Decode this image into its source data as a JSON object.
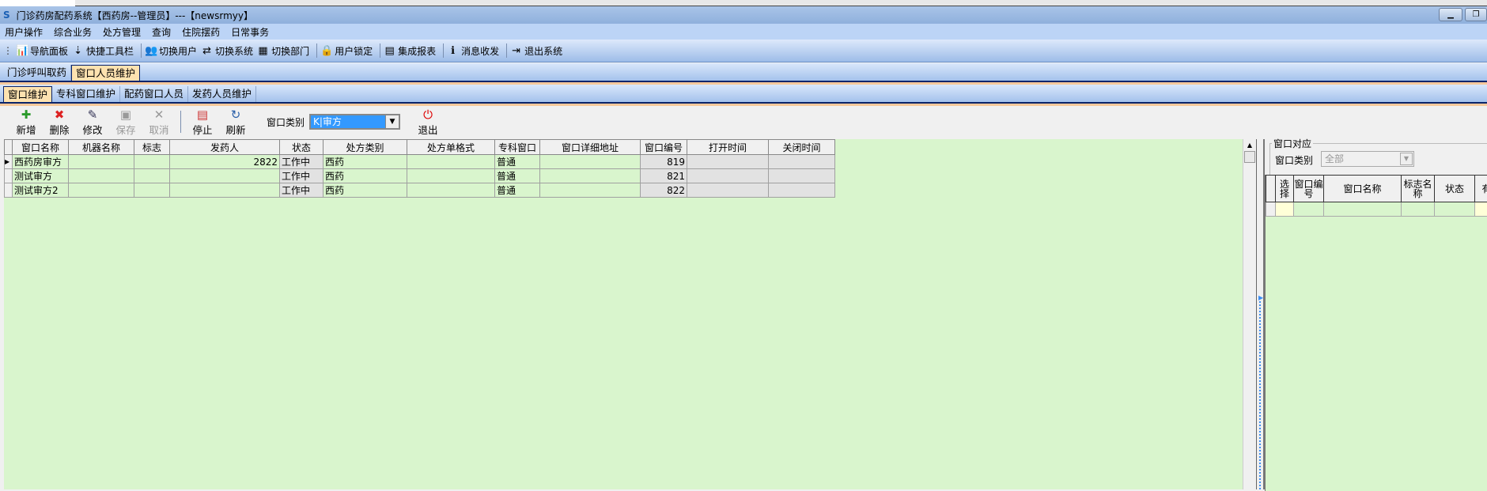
{
  "window": {
    "title": "门诊药房配药系统【西药房--管理员】---【newsrmyy】",
    "minimize_icon": "minimize-icon",
    "restore_icon": "restore-icon"
  },
  "menu": [
    "用户操作",
    "综合业务",
    "处方管理",
    "查询",
    "住院摆药",
    "日常事务"
  ],
  "toolbar": [
    {
      "label": "导航面板",
      "icon": "📊"
    },
    {
      "label": "快捷工具栏",
      "icon": "⇣"
    },
    {
      "label": "切换用户",
      "icon": "👥"
    },
    {
      "label": "切换系统",
      "icon": "⇄"
    },
    {
      "label": "切换部门",
      "icon": "▦"
    },
    {
      "label": "用户锁定",
      "icon": "🔒"
    },
    {
      "label": "集成报表",
      "icon": "▤"
    },
    {
      "label": "消息收发",
      "icon": "ℹ"
    },
    {
      "label": "退出系统",
      "icon": "⇥"
    }
  ],
  "tabs_main": [
    "门诊呼叫取药",
    "窗口人员维护"
  ],
  "tabs_sub": [
    "窗口维护",
    "专科窗口维护",
    "配药窗口人员",
    "发药人员维护"
  ],
  "actions": {
    "add": "新增",
    "delete": "删除",
    "edit": "修改",
    "save": "保存",
    "cancel": "取消",
    "stop": "停止",
    "refresh": "刷新",
    "window_type_label": "窗口类别",
    "window_type_value": "K|审方",
    "exit": "退出"
  },
  "grid": {
    "columns": [
      "窗口名称",
      "机器名称",
      "标志",
      "发药人",
      "状态",
      "处方类别",
      "处方单格式",
      "专科窗口",
      "窗口详细地址",
      "窗口编号",
      "打开时间",
      "关闭时间"
    ],
    "rows": [
      [
        "西药房审方",
        "",
        "",
        "2822",
        "工作中",
        "西药",
        "",
        "普通",
        "",
        "819",
        "",
        ""
      ],
      [
        "测试审方",
        "",
        "",
        "",
        "工作中",
        "西药",
        "",
        "普通",
        "",
        "821",
        "",
        ""
      ],
      [
        "测试审方2",
        "",
        "",
        "",
        "工作中",
        "西药",
        "",
        "普通",
        "",
        "822",
        "",
        ""
      ]
    ]
  },
  "right": {
    "group_title": "窗口对应",
    "type_label": "窗口类别",
    "type_value": "全部",
    "columns": [
      "选择",
      "窗口编号",
      "窗口名称",
      "标志名称",
      "状态",
      "有"
    ]
  },
  "colors": {
    "grid_bg": "#d9f5cd",
    "accent_tab": "#fde2b0",
    "selection": "#3399ff"
  }
}
